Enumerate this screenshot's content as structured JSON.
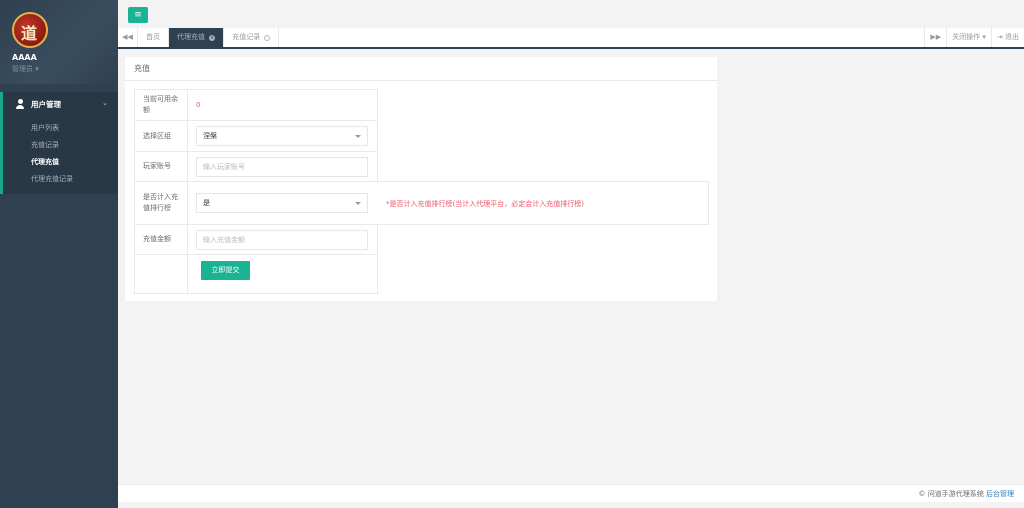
{
  "sidebar": {
    "username": "AAAA",
    "role": "管理员 ▾",
    "logo_glyph": "道",
    "section_title": "用户管理",
    "items": [
      {
        "label": "用户列表",
        "active": false
      },
      {
        "label": "充值记录",
        "active": false
      },
      {
        "label": "代理充值",
        "active": true
      },
      {
        "label": "代理充值记录",
        "active": false
      }
    ]
  },
  "topbar": {
    "menu_icon": "≡"
  },
  "tabs": {
    "left_arrow": "◀◀",
    "items": [
      {
        "label": "首页"
      },
      {
        "label": "代理充值"
      },
      {
        "label": "充值记录"
      }
    ],
    "right_arrow": "▶▶",
    "close_ops": "关闭操作 ▾",
    "logout": "退出"
  },
  "panel": {
    "title": "充值",
    "fields": {
      "balance_label": "当前可用余额",
      "balance_value": "0",
      "zone_label": "选择区组",
      "zone_value": "涅槃",
      "account_label": "玩家账号",
      "account_placeholder": "输入玩家账号",
      "rank_label": "是否计入充值排行榜",
      "rank_value": "是",
      "rank_hint": "*是否计入充值排行榜(当计入代理平台，必定会计入充值排行榜)",
      "amount_label": "充值金额",
      "amount_placeholder": "输入充值金额"
    },
    "submit_label": "立即提交"
  },
  "footer": {
    "text": "© 问道手游代理系统",
    "link": "后台管理"
  },
  "colors": {
    "sidebar_bg": "#2f4050",
    "accent": "#1ab394",
    "danger": "#ed5565"
  }
}
